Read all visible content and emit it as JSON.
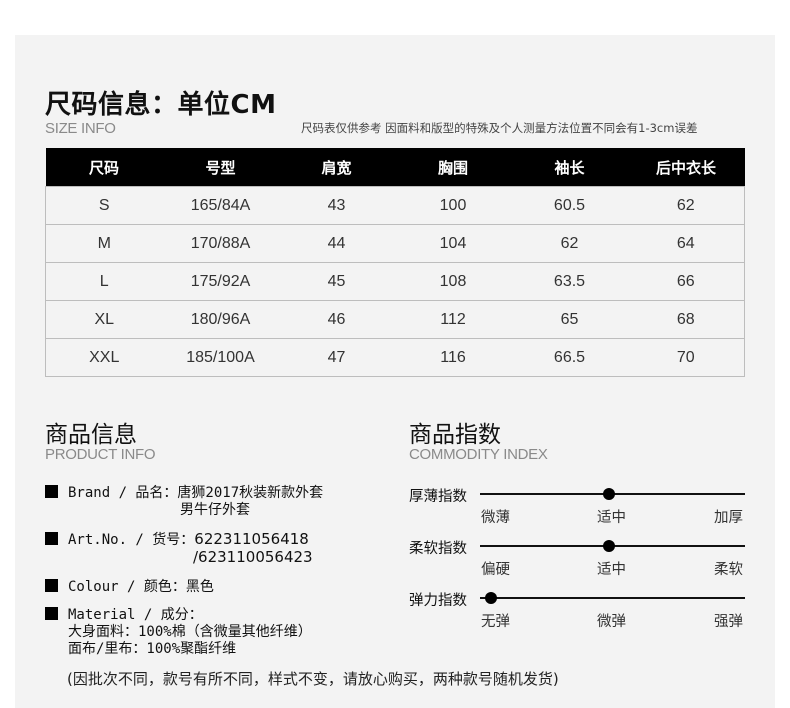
{
  "size_section": {
    "title": "尺码信息：单位CM",
    "subtitle": "SIZE INFO",
    "note": "尺码表仅供参考 因面料和版型的特殊及个人测量方法位置不同会有1-3cm误差",
    "headers": [
      "尺码",
      "号型",
      "肩宽",
      "胸围",
      "袖长",
      "后中衣长"
    ],
    "rows": [
      [
        "S",
        "165/84A",
        "43",
        "100",
        "60.5",
        "62"
      ],
      [
        "M",
        "170/88A",
        "44",
        "104",
        "62",
        "64"
      ],
      [
        "L",
        "175/92A",
        "45",
        "108",
        "63.5",
        "66"
      ],
      [
        "XL",
        "180/96A",
        "46",
        "112",
        "65",
        "68"
      ],
      [
        "XXL",
        "185/100A",
        "47",
        "116",
        "66.5",
        "70"
      ]
    ]
  },
  "product_info": {
    "title": "商品信息",
    "subtitle": "PRODUCT INFO",
    "brand_line1": "Brand / 品名：唐狮2017秋装新款外套",
    "brand_line2": "男牛仔外套",
    "artno_label": "Art.No. / 货号：",
    "artno_value1": "622311056418",
    "artno_value2": "/623110056423",
    "colour": "Colour / 颜色：黑色",
    "material_label": "Material / 成分：",
    "material_line1": "大身面料：100%棉（含微量其他纤维）",
    "material_line2": "面布/里布：100%聚酯纤维",
    "footer_note": "(因批次不同，款号有所不同，样式不变，请放心购买，两种款号随机发货)"
  },
  "commodity_index": {
    "title": "商品指数",
    "subtitle": "COMMODITY INDEX",
    "indices": [
      {
        "label": "厚薄指数",
        "ticks": [
          "微薄",
          "适中",
          "加厚"
        ],
        "level": 0.5
      },
      {
        "label": "柔软指数",
        "ticks": [
          "偏硬",
          "适中",
          "柔软"
        ],
        "level": 0.5
      },
      {
        "label": "弹力指数",
        "ticks": [
          "无弹",
          "微弹",
          "强弹"
        ],
        "level": 0.0
      }
    ]
  }
}
